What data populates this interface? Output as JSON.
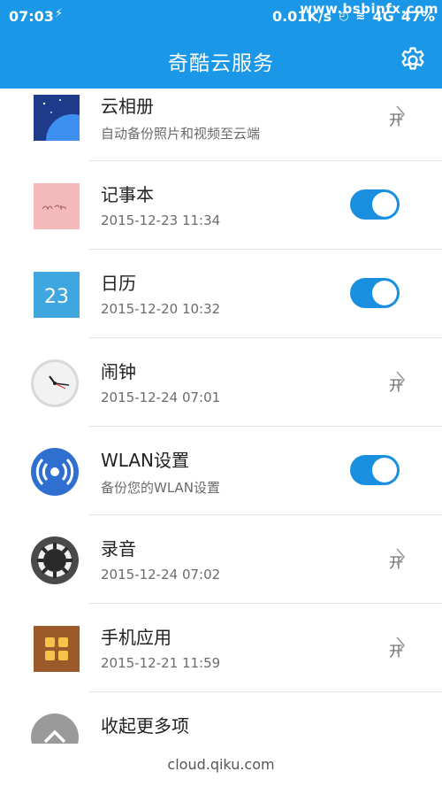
{
  "status_bar": {
    "time": "07:03",
    "speed": "0.01K/s",
    "network": "4G",
    "battery": "47%",
    "watermark": "www.bsbinfx.com"
  },
  "app_bar": {
    "title": "奇酷云服务",
    "settings_icon": "gear-icon"
  },
  "items": [
    {
      "name": "云相册",
      "sub": "自动备份照片和视频至云端",
      "control": "link",
      "status": "开"
    },
    {
      "name": "记事本",
      "sub": "2015-12-23 11:34",
      "control": "toggle",
      "on": true
    },
    {
      "name": "日历",
      "sub": "2015-12-20 10:32",
      "control": "toggle",
      "on": true,
      "icon_text": "23"
    },
    {
      "name": "闹钟",
      "sub": "2015-12-24 07:01",
      "control": "link",
      "status": "开"
    },
    {
      "name": "WLAN设置",
      "sub": "备份您的WLAN设置",
      "control": "toggle",
      "on": true
    },
    {
      "name": "录音",
      "sub": "2015-12-24 07:02",
      "control": "link",
      "status": "开"
    },
    {
      "name": "手机应用",
      "sub": "2015-12-21 11:59",
      "control": "link",
      "status": "开"
    },
    {
      "name": "收起更多项"
    }
  ],
  "footer": {
    "url": "cloud.qiku.com"
  },
  "colors": {
    "accent": "#1a97e6",
    "toggle_on": "#1a8fe0"
  }
}
